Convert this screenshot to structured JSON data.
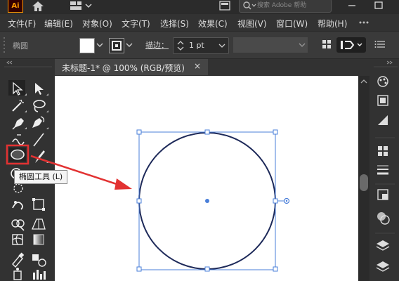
{
  "app": {
    "logo_text": "Ai"
  },
  "titlebar": {
    "search_placeholder": "搜索 Adobe 帮助"
  },
  "menu": [
    "文件(F)",
    "编辑(E)",
    "对象(O)",
    "文字(T)",
    "选择(S)",
    "效果(C)",
    "视图(V)",
    "窗口(W)",
    "帮助(H)"
  ],
  "control": {
    "tool_name": "椭圆",
    "stroke_label": "描边：",
    "stroke_weight": "1 pt",
    "fill_color": "#ffffff"
  },
  "document": {
    "tab_title": "未标题-1* @ 100% (RGB/预览)",
    "close_glyph": "×"
  },
  "tooltip": {
    "text": "椭圆工具 (L)"
  },
  "tools": [
    "selection-tool",
    "direct-selection-tool",
    "magic-wand-tool",
    "lasso-tool",
    "pen-tool",
    "curvature-tool",
    "pencil-tool",
    "line-segment-tool",
    "ellipse-tool",
    "paintbrush-tool",
    "rotate-tool",
    "scale-tool",
    "warp-tool",
    "free-transform-tool",
    "shape-builder-tool",
    "perspective-grid-tool",
    "mesh-tool",
    "gradient-tool",
    "eyedropper-tool",
    "blend-tool",
    "symbol-sprayer-tool",
    "column-graph-tool"
  ],
  "right_panels": [
    "properties-icon",
    "libraries-icon",
    "color-guide-icon",
    "swatches-icon",
    "stroke-panel-icon",
    "transparency-icon",
    "appearance-icon",
    "layers-icon",
    "artboards-icon"
  ],
  "colors": {
    "ui_dark": "#323232",
    "highlight": "#e23232",
    "selection_blue": "#4a7fd9",
    "circle_stroke": "#1e2a5a"
  }
}
